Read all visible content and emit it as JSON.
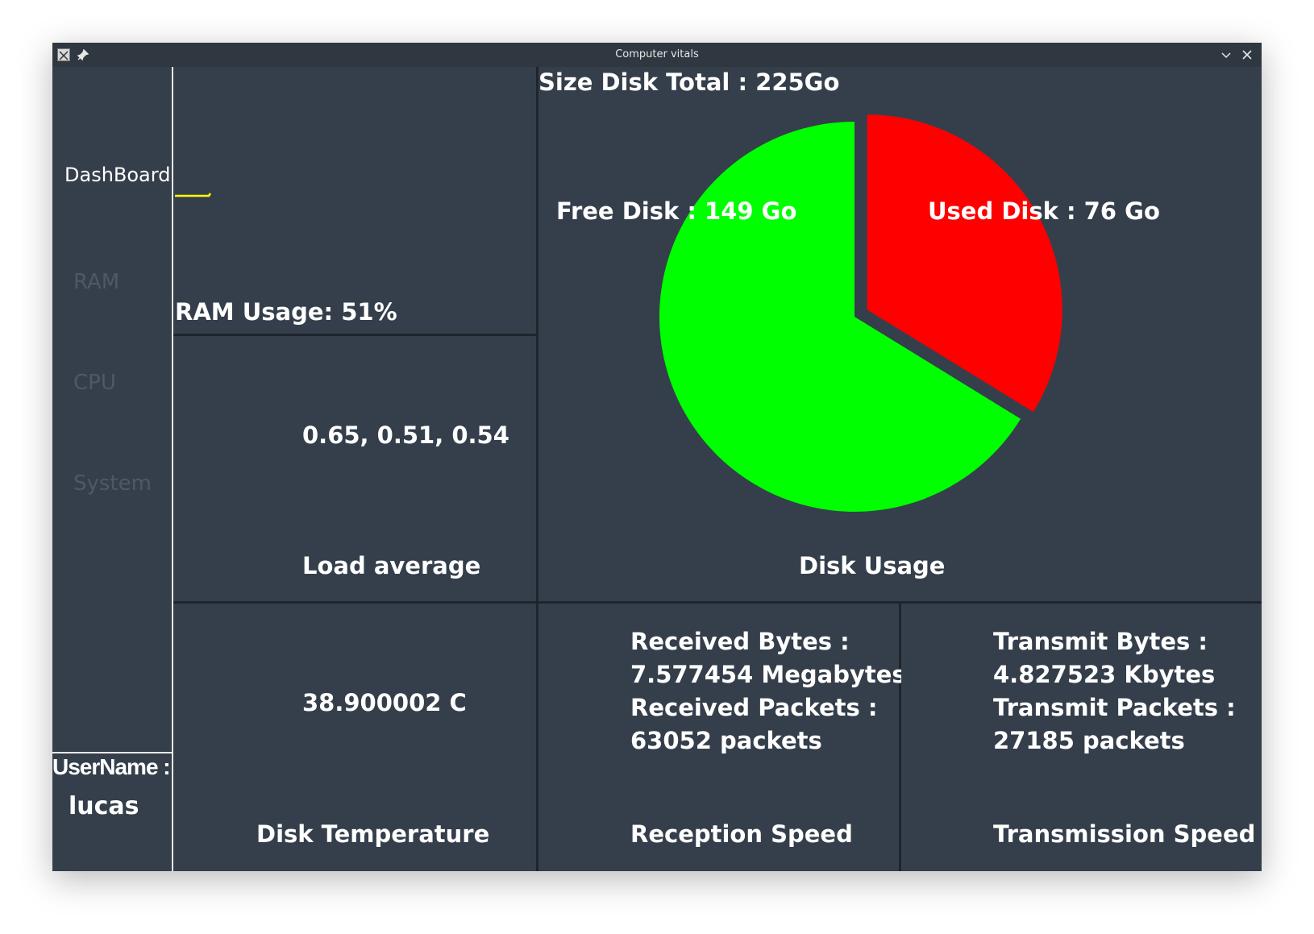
{
  "window": {
    "title": "Computer vitals"
  },
  "sidebar": {
    "items": [
      {
        "label": "DashBoard",
        "active": true
      },
      {
        "label": "RAM",
        "active": false
      },
      {
        "label": "CPU",
        "active": false
      },
      {
        "label": "System",
        "active": false
      }
    ],
    "user_label": "UserName :",
    "user_name": "lucas"
  },
  "ram": {
    "label": "RAM Usage: 51%",
    "line_color": "#ffff00"
  },
  "load": {
    "value": "0.65, 0.51, 0.54",
    "title": "Load average"
  },
  "disk": {
    "total_label": "Size Disk Total : 225Go",
    "free_label": "Free Disk : 149 Go",
    "used_label": "Used Disk : 76 Go",
    "title": "Disk Usage",
    "colors": {
      "free": "#00ff00",
      "used": "#ff0000"
    }
  },
  "temperature": {
    "value": "38.900002 C",
    "title": "Disk Temperature"
  },
  "reception": {
    "lines": [
      "Received Bytes :",
      "7.577454 Megabytes",
      "Received Packets :",
      "63052 packets"
    ],
    "title": "Reception Speed"
  },
  "transmission": {
    "lines": [
      "Transmit Bytes :",
      "4.827523 Kbytes",
      "Transmit Packets :",
      "27185 packets"
    ],
    "title": "Transmission Speed"
  },
  "chart_data": {
    "type": "pie",
    "title": "Size Disk Total : 225Go",
    "categories": [
      "Used Disk",
      "Free Disk"
    ],
    "values": [
      76,
      149
    ],
    "unit": "Go",
    "colors": [
      "#ff0000",
      "#00ff00"
    ]
  }
}
